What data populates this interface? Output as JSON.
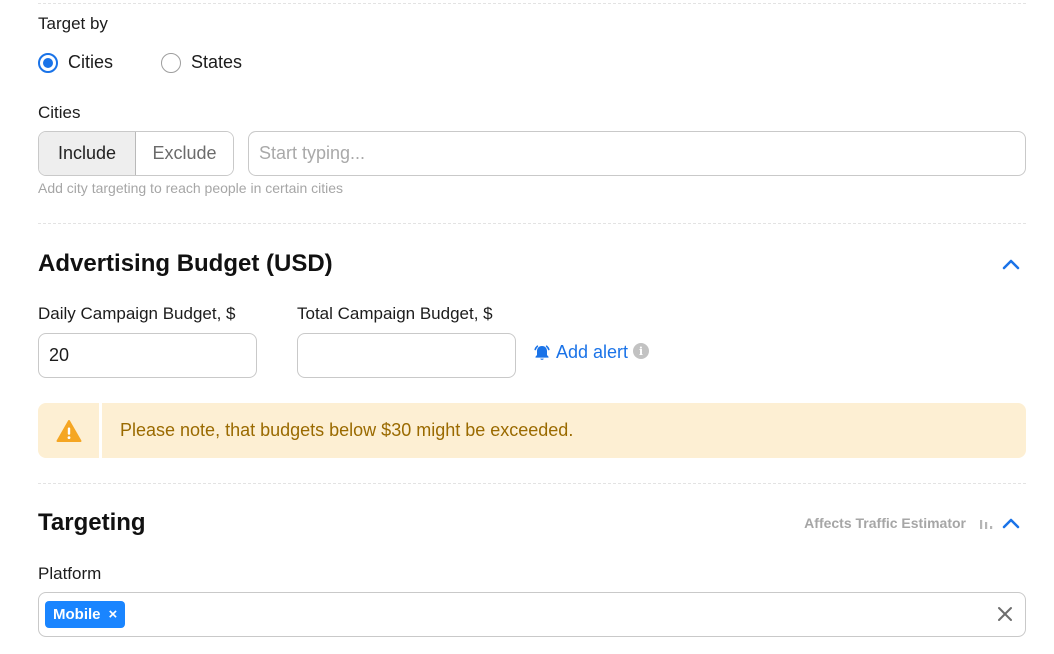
{
  "target_by": {
    "label": "Target by",
    "options": [
      {
        "label": "Cities",
        "checked": true
      },
      {
        "label": "States",
        "checked": false
      }
    ]
  },
  "cities": {
    "label": "Cities",
    "include_label": "Include",
    "exclude_label": "Exclude",
    "input_placeholder": "Start typing...",
    "input_value": "",
    "help": "Add city targeting to reach people in certain cities"
  },
  "budget": {
    "title": "Advertising Budget (USD)",
    "daily_label": "Daily Campaign Budget, $",
    "daily_value": "20",
    "total_label": "Total Campaign Budget, $",
    "total_value": "",
    "add_alert": "Add alert",
    "info_glyph": "i",
    "warning": "Please note, that budgets below $30 might be exceeded."
  },
  "targeting": {
    "title": "Targeting",
    "affects": "Affects Traffic Estimator",
    "platform_label": "Platform",
    "chips": [
      {
        "label": "Mobile",
        "remove": "×"
      }
    ]
  },
  "colors": {
    "accent": "#1a73e8",
    "chip": "#1a85ff",
    "warning_bg": "#fdefd3",
    "warning_text": "#9a6a00",
    "warning_icon": "#f5a623"
  },
  "icons": [
    "chevron-up-icon",
    "bell-icon",
    "info-icon",
    "warning-icon",
    "bar-chart-icon",
    "close-icon"
  ]
}
